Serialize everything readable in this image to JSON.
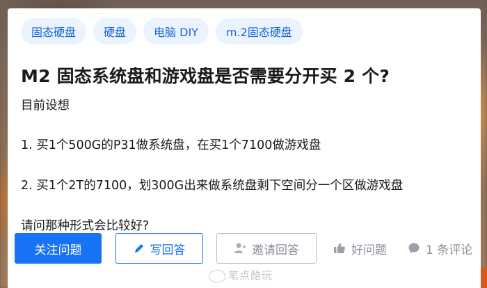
{
  "tags": [
    "固态硬盘",
    "硬盘",
    "电脑 DIY",
    "m.2固态硬盘"
  ],
  "question": {
    "title": "M2 固态系统盘和游戏盘是否需要分开买 2 个?",
    "lines": [
      "目前设想",
      "1. 买1个500G的P31做系统盘，在买1个7100做游戏盘",
      "2. 买1个2T的7100，划300G出来做系统盘剩下空间分一个区做游戏盘",
      "请问那种形式会比较好?"
    ]
  },
  "actions": {
    "follow_label": "关注问题",
    "answer_label": "写回答",
    "invite_label": "邀请回答",
    "good_question_label": "好问题",
    "comments_label": "1 条评论"
  },
  "icons": {
    "answer": "pencil-icon",
    "invite": "add-user-icon",
    "good": "thumbs-up-icon",
    "comments": "comment-bubble-icon"
  },
  "colors": {
    "accent": "#1772f6",
    "tag_bg": "#ebf3ff",
    "tag_text": "#1765d8",
    "muted": "#8a8f99"
  },
  "watermark": "笔点酷玩"
}
